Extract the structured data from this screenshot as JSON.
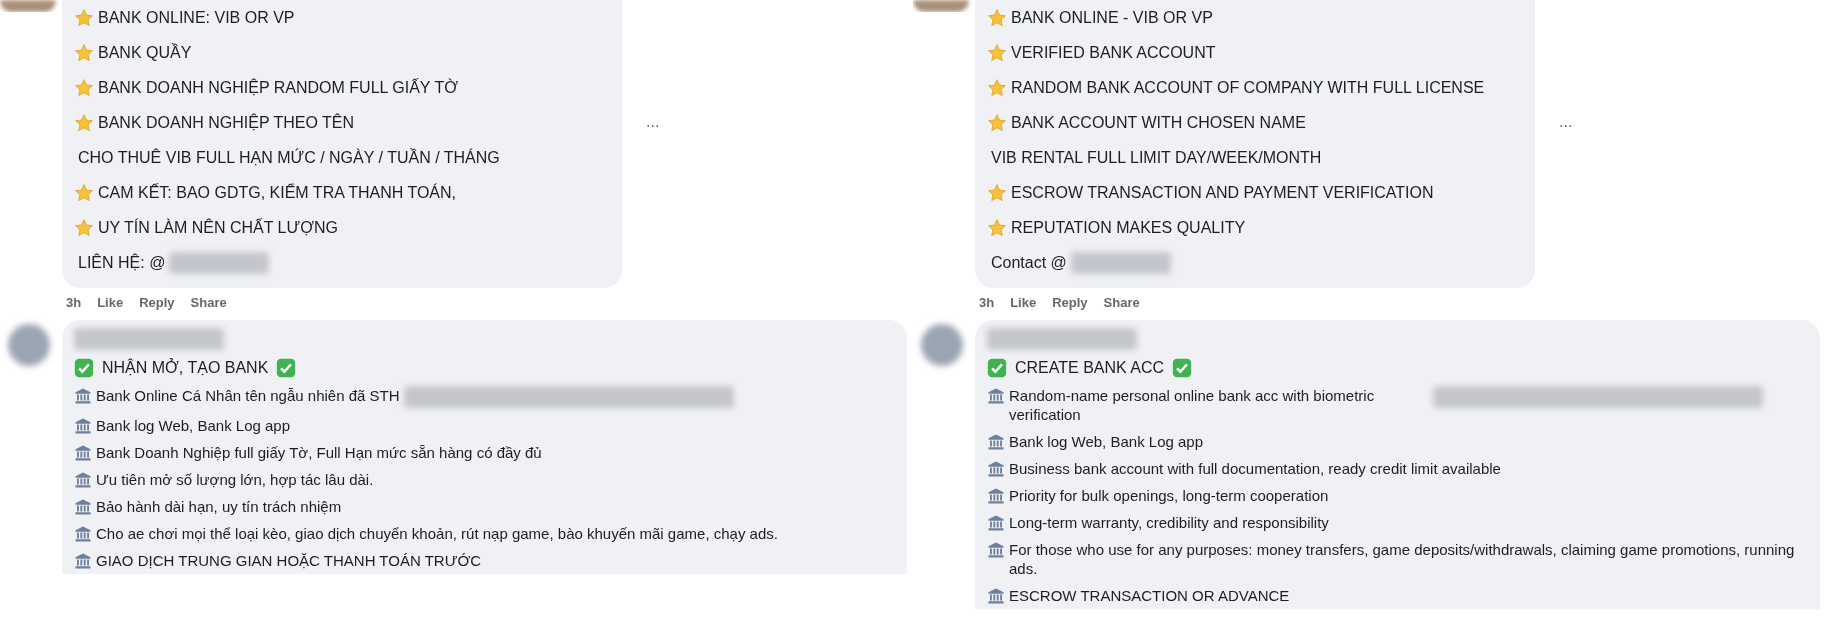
{
  "panels": [
    {
      "top_comment": {
        "lines": [
          {
            "kind": "star",
            "text": "BANK ONLINE: VIB OR VP"
          },
          {
            "kind": "star",
            "text": "BANK QUẦY"
          },
          {
            "kind": "star",
            "text": "BANK DOANH NGHIỆP RANDOM FULL GIẤY TỜ"
          },
          {
            "kind": "star",
            "text": "BANK DOANH NGHIỆP THEO TÊN"
          },
          {
            "kind": "plain",
            "text": "CHO THUÊ VIB FULL HẠN MỨC / NGÀY / TUẦN / THÁNG"
          },
          {
            "kind": "star",
            "text": "CAM KẾT: BAO GDTG, KIỂM TRA THANH TOÁN,"
          },
          {
            "kind": "star",
            "text": "UY TÍN LÀM NÊN CHẤT LƯỢNG"
          },
          {
            "kind": "plain",
            "text": "LIÊN HỆ: @",
            "redacted": true
          }
        ],
        "more": "...",
        "actions": [
          "3h",
          "Like",
          "Reply",
          "Share"
        ]
      },
      "bottom_comment": {
        "heading": "NHẬN MỞ, TẠO BANK",
        "lines": [
          {
            "kind": "bank",
            "text": "Bank Online Cá Nhân tên ngẫu nhiên đã STH",
            "redacted": true
          },
          {
            "kind": "bank",
            "text": "Bank log Web, Bank Log app"
          },
          {
            "kind": "bank",
            "text": "Bank Doanh Nghiệp full giấy Tờ, Full Hạn mức sẵn hàng có đầy đủ"
          },
          {
            "kind": "bank",
            "text": "Ưu tiên mở số lượng lớn, hợp tác lâu dài."
          },
          {
            "kind": "bank",
            "text": "Bảo hành dài hạn, uy tín trách nhiệm"
          },
          {
            "kind": "bank",
            "text": "Cho ae chơi mọi thể loại kèo, giao dịch chuyển khoản, rút nạp game, bào khuyến mãi game, chạy ads."
          },
          {
            "kind": "bank",
            "text": "GIAO DỊCH TRUNG GIAN HOẶC THANH TOÁN TRƯỚC"
          }
        ]
      }
    },
    {
      "top_comment": {
        "lines": [
          {
            "kind": "star",
            "text": "BANK ONLINE - VIB OR VP"
          },
          {
            "kind": "star",
            "text": "VERIFIED BANK ACCOUNT"
          },
          {
            "kind": "star",
            "text": "RANDOM BANK ACCOUNT OF COMPANY WITH FULL LICENSE"
          },
          {
            "kind": "star",
            "text": "BANK ACCOUNT WITH CHOSEN NAME"
          },
          {
            "kind": "plain",
            "text": "VIB RENTAL FULL LIMIT DAY/WEEK/MONTH"
          },
          {
            "kind": "star",
            "text": "ESCROW TRANSACTION AND PAYMENT VERIFICATION"
          },
          {
            "kind": "star",
            "text": "REPUTATION MAKES QUALITY"
          },
          {
            "kind": "plain",
            "text": "Contact @",
            "redacted": true
          }
        ],
        "more": "...",
        "actions": [
          "3h",
          "Like",
          "Reply",
          "Share"
        ]
      },
      "bottom_comment": {
        "heading": "CREATE BANK ACC",
        "lines": [
          {
            "kind": "bank",
            "text": "Random-name personal online bank acc with biometric verification",
            "redacted": true
          },
          {
            "kind": "bank",
            "text": "Bank log Web, Bank Log app"
          },
          {
            "kind": "bank",
            "text": "Business bank account with full documentation, ready credit limit available"
          },
          {
            "kind": "bank",
            "text": "Priority for bulk openings, long-term cooperation"
          },
          {
            "kind": "bank",
            "text": "Long-term warranty, credibility and responsibility"
          },
          {
            "kind": "bank",
            "text": "For those who use for any purposes: money transfers, game deposits/withdrawals, claiming game promotions, running ads."
          },
          {
            "kind": "bank",
            "text": "ESCROW TRANSACTION OR ADVANCE"
          }
        ]
      }
    }
  ]
}
